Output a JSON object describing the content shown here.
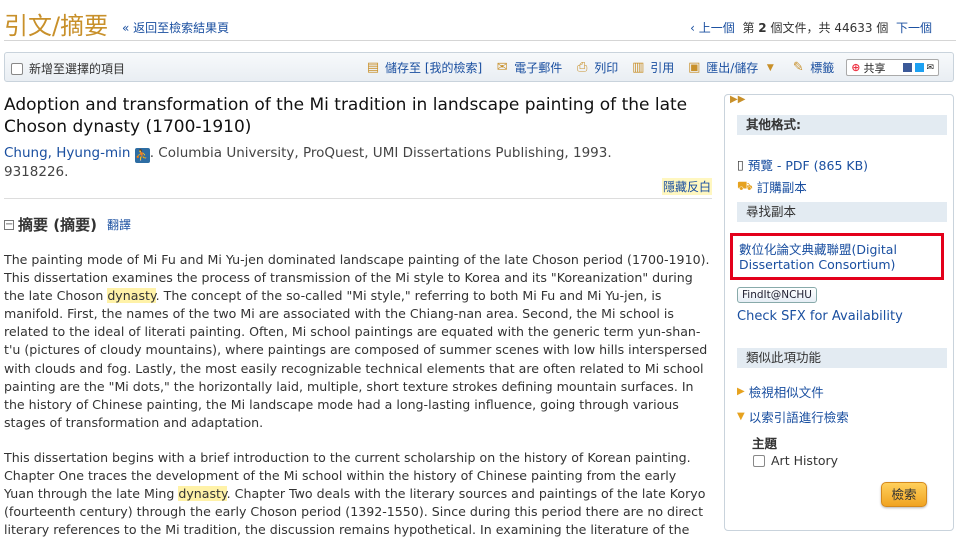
{
  "header": {
    "title": "引文/摘要",
    "back_link": "« 返回至檢索結果頁",
    "pager": {
      "prev": "‹ 上一個",
      "text_a": "第",
      "current": "2",
      "text_b": "個文件，共",
      "total": "44633",
      "text_c": "個",
      "next": "下一個"
    }
  },
  "toolbar": {
    "add_selected": "新增至選擇的項目",
    "save_to": "儲存至 [我的檢索]",
    "email": "電子郵件",
    "print": "列印",
    "cite": "引用",
    "export": "匯出/儲存",
    "tags": "標籤",
    "share": "共享"
  },
  "document": {
    "title": "Adoption and transformation of the Mi tradition in landscape painting of the late Choson dynasty (1700-1910)",
    "author": "Chung, Hyung-min",
    "publication": ". Columbia University, ProQuest, UMI Dissertations Publishing, 1993.",
    "number": "9318226.",
    "hide_toggle": "隱藏反白"
  },
  "abstract": {
    "heading": "摘要 (摘要)",
    "translate": "翻譯",
    "p1_a": "The painting mode of Mi Fu and Mi Yu-jen dominated landscape painting of the late Choson period (1700-1910). This dissertation examines the process of transmission of the Mi style to Korea and its \"Koreanization\" during the late Choson ",
    "p1_hl": "dynasty",
    "p1_b": ". The concept of the so-called \"Mi style,\" referring to both Mi Fu and Mi Yu-jen, is manifold. First, the names of the two Mi are associated with the Chiang-nan area. Second, the Mi school is related to the ideal of literati painting. Often, Mi school paintings are equated with the generic term yun-shan-t'u (pictures of cloudy mountains), where paintings are composed of summer scenes with low hills interspersed with clouds and fog. Lastly, the most easily recognizable technical elements that are often related to Mi school painting are the \"Mi dots,\" the horizontally laid, multiple, short texture strokes defining mountain surfaces. In the history of Chinese painting, the Mi landscape mode had a long-lasting influence, going through various stages of transformation and adaptation.",
    "p2_a": "This dissertation begins with a brief introduction to the current scholarship on the history of Korean painting. Chapter One traces the development of the Mi school within the history of Chinese painting from the early Yuan through the late Ming ",
    "p2_hl": "dynasty",
    "p2_b": ". Chapter Two deals with the literary sources and paintings of the late Koryo (fourteenth century) through the early Choson period (1392-1550). Since during this period there are no direct literary references to the Mi tradition, the discussion remains hypothetical. In examining the literature of the"
  },
  "sidebar": {
    "other_formats": "其他格式:",
    "preview": "預覽 - PDF (865 KB)",
    "order_copy": "訂購副本",
    "find_copy": "尋找副本",
    "digital_consortium": "數位化論文典藏聯盟(Digital Dissertation Consortium)",
    "findit": "FindIt@NCHU",
    "sfx": "Check SFX for Availability",
    "similar": "類似此項功能",
    "view_similar": "檢視相似文件",
    "index_search": "以索引語進行檢索",
    "subject_label": "主題",
    "subject_item": "Art History",
    "search_button": "檢索"
  }
}
